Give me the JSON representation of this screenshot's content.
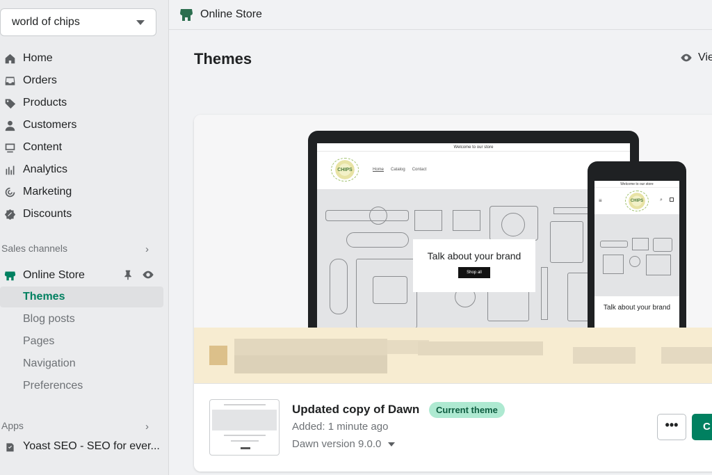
{
  "store": {
    "name": "world of chips"
  },
  "sidebar": {
    "items": [
      {
        "label": "Home",
        "icon": "home-icon"
      },
      {
        "label": "Orders",
        "icon": "inbox-icon"
      },
      {
        "label": "Products",
        "icon": "tag-icon"
      },
      {
        "label": "Customers",
        "icon": "person-icon"
      },
      {
        "label": "Content",
        "icon": "content-icon"
      },
      {
        "label": "Analytics",
        "icon": "bar-chart-icon"
      },
      {
        "label": "Marketing",
        "icon": "target-icon"
      },
      {
        "label": "Discounts",
        "icon": "discount-icon"
      }
    ],
    "sales_channels_label": "Sales channels",
    "online_store": {
      "label": "Online Store",
      "sub_items": [
        "Themes",
        "Blog posts",
        "Pages",
        "Navigation",
        "Preferences"
      ],
      "active": "Themes"
    },
    "apps_label": "Apps",
    "apps": [
      {
        "label": "Yoast SEO - SEO for ever..."
      }
    ]
  },
  "topbar": {
    "title": "Online Store"
  },
  "page": {
    "title": "Themes",
    "view_store_label": "Vie"
  },
  "preview": {
    "laptop": {
      "banner": "Welcome to our store",
      "nav": [
        "Home",
        "Catalog",
        "Contact"
      ],
      "logo_text": "CHIPS",
      "hero_text": "Talk about your brand",
      "hero_button": "Shop all"
    },
    "phone": {
      "banner": "Welcome to our store",
      "logo_text": "CHIPS",
      "hero_text": "Talk about your brand"
    }
  },
  "theme": {
    "name": "Updated copy of Dawn",
    "badge": "Current theme",
    "added": "Added: 1 minute ago",
    "version": "Dawn version 9.0.0",
    "more_label": "•••",
    "primary_label": "C"
  },
  "colors": {
    "accent": "#008060",
    "badge_bg": "#aee9d1",
    "sidebar_bg": "#ebecee"
  }
}
